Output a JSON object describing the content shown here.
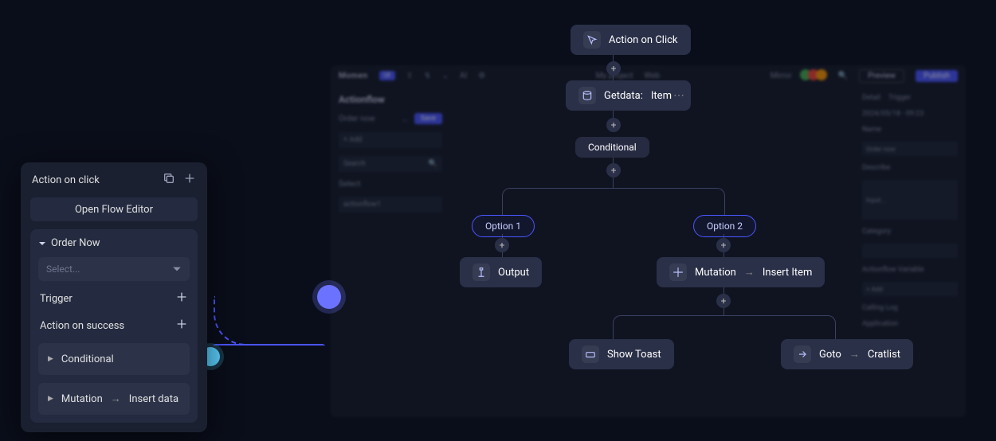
{
  "bg": {
    "brand": "Momen",
    "project_label": "My project",
    "env_label": "Web",
    "mirror": "Mirror",
    "preview": "Preview",
    "publish": "Publish",
    "left": {
      "actionflow": "Actionflow",
      "add": "+  Add",
      "search_ph": "Search",
      "select_label": "Select",
      "selected": "actionflow1"
    },
    "center": {
      "order_now": "Order now",
      "save": "Save"
    },
    "right": {
      "tab_detail": "Detail",
      "tab_trigger": "Trigger",
      "timestamp": "2024/05/18 - 09:23",
      "name_label": "Name",
      "name_value": "Order now",
      "describe_label": "Describe",
      "describe_ph": "Input...",
      "category_label": "Category",
      "var_label": "Actionflow Variable",
      "add_btn": "+  Add",
      "calling_log": "Calling Log",
      "application": "Application"
    }
  },
  "flow": {
    "n_click": "Action on Click",
    "n_getdata_a": "Getdata:",
    "n_getdata_b": "Item",
    "n_cond": "Conditional",
    "n_opt1": "Option 1",
    "n_opt2": "Option 2",
    "n_output": "Output",
    "n_mutation": "Mutation",
    "n_insert_item": "Insert Item",
    "n_toast": "Show Toast",
    "n_goto": "Goto",
    "n_cratlist": "Cratlist"
  },
  "panel": {
    "title": "Action on click",
    "open_editor": "Open Flow Editor",
    "group_order": "Order Now",
    "select_ph": "Select...",
    "trigger": "Trigger",
    "on_success": "Action on success",
    "item_cond": "Conditional",
    "item_mut": "Mutation",
    "item_insert": "Insert data"
  }
}
